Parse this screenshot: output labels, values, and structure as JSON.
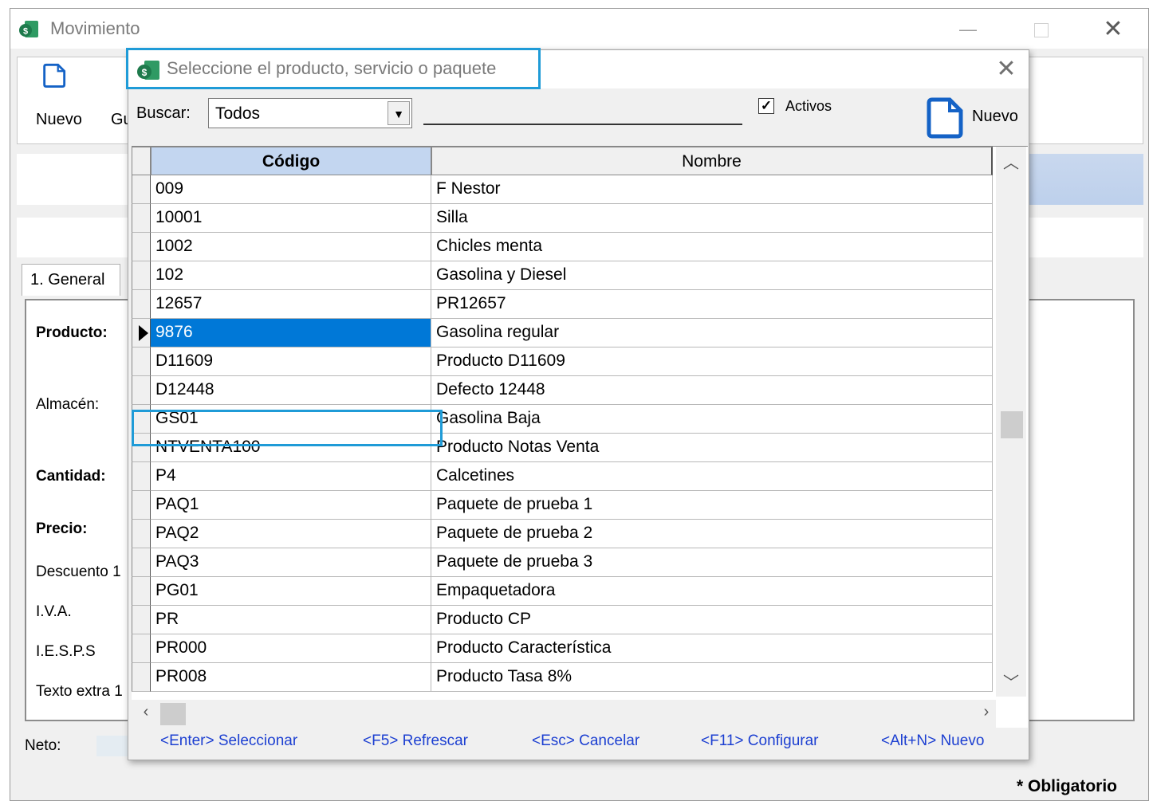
{
  "background_window": {
    "title": "Movimiento",
    "toolbar": {
      "new_label": "Nuevo",
      "save_label_partial": "Gu"
    },
    "tab_general": "1. General",
    "fields": {
      "producto": "Producto:",
      "almacen": "Almacén:",
      "cantidad": "Cantidad:",
      "precio": "Precio:",
      "descuento": "Descuento 1",
      "iva": "I.V.A.",
      "iesps": "I.E.S.P.S",
      "texto_extra": "Texto extra 1"
    },
    "neto_label": "Neto:",
    "obligatorio": "* Obligatorio"
  },
  "dialog": {
    "title": "Seleccione el producto, servicio o paquete",
    "search_label": "Buscar:",
    "search_filter_value": "Todos",
    "search_text": "",
    "activos_label": "Activos",
    "activos_checked": true,
    "new_button_label": "Nuevo",
    "columns": {
      "codigo": "Código",
      "nombre": "Nombre"
    },
    "selected_index": 5,
    "rows": [
      {
        "codigo": "009",
        "nombre": "F Nestor"
      },
      {
        "codigo": "10001",
        "nombre": "Silla"
      },
      {
        "codigo": "1002",
        "nombre": "Chicles menta"
      },
      {
        "codigo": "102",
        "nombre": "Gasolina y Diesel"
      },
      {
        "codigo": "12657",
        "nombre": "PR12657"
      },
      {
        "codigo": "9876",
        "nombre": "Gasolina regular"
      },
      {
        "codigo": "D11609",
        "nombre": "Producto D11609"
      },
      {
        "codigo": "D12448",
        "nombre": "Defecto 12448"
      },
      {
        "codigo": "GS01",
        "nombre": "Gasolina Baja"
      },
      {
        "codigo": "NTVENTA100",
        "nombre": "Producto Notas Venta"
      },
      {
        "codigo": "P4",
        "nombre": "Calcetines"
      },
      {
        "codigo": "PAQ1",
        "nombre": "Paquete de prueba 1"
      },
      {
        "codigo": "PAQ2",
        "nombre": "Paquete de prueba 2"
      },
      {
        "codigo": "PAQ3",
        "nombre": "Paquete de prueba 3"
      },
      {
        "codigo": "PG01",
        "nombre": "Empaquetadora"
      },
      {
        "codigo": "PR",
        "nombre": "Producto CP"
      },
      {
        "codigo": "PR000",
        "nombre": "Producto Característica"
      },
      {
        "codigo": "PR008",
        "nombre": "Producto Tasa 8%"
      }
    ],
    "footer_links": [
      "<Enter> Seleccionar",
      "<F5> Refrescar",
      "<Esc> Cancelar",
      "<F11> Configurar",
      "<Alt+N> Nuevo"
    ]
  },
  "colors": {
    "selection": "#0078d7",
    "highlight_outline": "#1f9bd7",
    "header_selected": "#c3d6f0",
    "link": "#1c3fd1",
    "app_icon": "#1e8a55"
  }
}
